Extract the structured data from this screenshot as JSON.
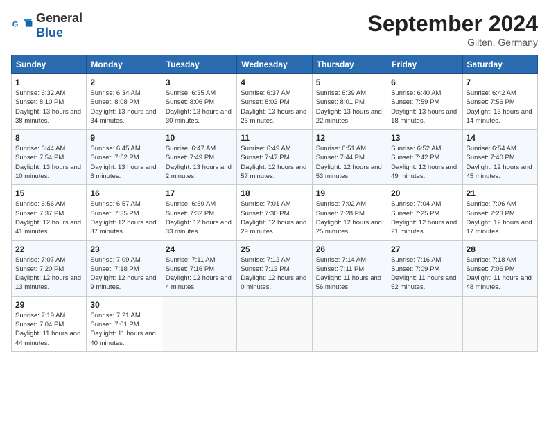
{
  "header": {
    "logo_general": "General",
    "logo_blue": "Blue",
    "month_title": "September 2024",
    "location": "Gilten, Germany"
  },
  "days_of_week": [
    "Sunday",
    "Monday",
    "Tuesday",
    "Wednesday",
    "Thursday",
    "Friday",
    "Saturday"
  ],
  "weeks": [
    [
      {
        "day": "1",
        "sunrise": "6:32 AM",
        "sunset": "8:10 PM",
        "daylight": "Daylight: 13 hours and 38 minutes."
      },
      {
        "day": "2",
        "sunrise": "6:34 AM",
        "sunset": "8:08 PM",
        "daylight": "Daylight: 13 hours and 34 minutes."
      },
      {
        "day": "3",
        "sunrise": "6:35 AM",
        "sunset": "8:06 PM",
        "daylight": "Daylight: 13 hours and 30 minutes."
      },
      {
        "day": "4",
        "sunrise": "6:37 AM",
        "sunset": "8:03 PM",
        "daylight": "Daylight: 13 hours and 26 minutes."
      },
      {
        "day": "5",
        "sunrise": "6:39 AM",
        "sunset": "8:01 PM",
        "daylight": "Daylight: 13 hours and 22 minutes."
      },
      {
        "day": "6",
        "sunrise": "6:40 AM",
        "sunset": "7:59 PM",
        "daylight": "Daylight: 13 hours and 18 minutes."
      },
      {
        "day": "7",
        "sunrise": "6:42 AM",
        "sunset": "7:56 PM",
        "daylight": "Daylight: 13 hours and 14 minutes."
      }
    ],
    [
      {
        "day": "8",
        "sunrise": "6:44 AM",
        "sunset": "7:54 PM",
        "daylight": "Daylight: 13 hours and 10 minutes."
      },
      {
        "day": "9",
        "sunrise": "6:45 AM",
        "sunset": "7:52 PM",
        "daylight": "Daylight: 13 hours and 6 minutes."
      },
      {
        "day": "10",
        "sunrise": "6:47 AM",
        "sunset": "7:49 PM",
        "daylight": "Daylight: 13 hours and 2 minutes."
      },
      {
        "day": "11",
        "sunrise": "6:49 AM",
        "sunset": "7:47 PM",
        "daylight": "Daylight: 12 hours and 57 minutes."
      },
      {
        "day": "12",
        "sunrise": "6:51 AM",
        "sunset": "7:44 PM",
        "daylight": "Daylight: 12 hours and 53 minutes."
      },
      {
        "day": "13",
        "sunrise": "6:52 AM",
        "sunset": "7:42 PM",
        "daylight": "Daylight: 12 hours and 49 minutes."
      },
      {
        "day": "14",
        "sunrise": "6:54 AM",
        "sunset": "7:40 PM",
        "daylight": "Daylight: 12 hours and 45 minutes."
      }
    ],
    [
      {
        "day": "15",
        "sunrise": "6:56 AM",
        "sunset": "7:37 PM",
        "daylight": "Daylight: 12 hours and 41 minutes."
      },
      {
        "day": "16",
        "sunrise": "6:57 AM",
        "sunset": "7:35 PM",
        "daylight": "Daylight: 12 hours and 37 minutes."
      },
      {
        "day": "17",
        "sunrise": "6:59 AM",
        "sunset": "7:32 PM",
        "daylight": "Daylight: 12 hours and 33 minutes."
      },
      {
        "day": "18",
        "sunrise": "7:01 AM",
        "sunset": "7:30 PM",
        "daylight": "Daylight: 12 hours and 29 minutes."
      },
      {
        "day": "19",
        "sunrise": "7:02 AM",
        "sunset": "7:28 PM",
        "daylight": "Daylight: 12 hours and 25 minutes."
      },
      {
        "day": "20",
        "sunrise": "7:04 AM",
        "sunset": "7:25 PM",
        "daylight": "Daylight: 12 hours and 21 minutes."
      },
      {
        "day": "21",
        "sunrise": "7:06 AM",
        "sunset": "7:23 PM",
        "daylight": "Daylight: 12 hours and 17 minutes."
      }
    ],
    [
      {
        "day": "22",
        "sunrise": "7:07 AM",
        "sunset": "7:20 PM",
        "daylight": "Daylight: 12 hours and 13 minutes."
      },
      {
        "day": "23",
        "sunrise": "7:09 AM",
        "sunset": "7:18 PM",
        "daylight": "Daylight: 12 hours and 9 minutes."
      },
      {
        "day": "24",
        "sunrise": "7:11 AM",
        "sunset": "7:16 PM",
        "daylight": "Daylight: 12 hours and 4 minutes."
      },
      {
        "day": "25",
        "sunrise": "7:12 AM",
        "sunset": "7:13 PM",
        "daylight": "Daylight: 12 hours and 0 minutes."
      },
      {
        "day": "26",
        "sunrise": "7:14 AM",
        "sunset": "7:11 PM",
        "daylight": "Daylight: 11 hours and 56 minutes."
      },
      {
        "day": "27",
        "sunrise": "7:16 AM",
        "sunset": "7:09 PM",
        "daylight": "Daylight: 11 hours and 52 minutes."
      },
      {
        "day": "28",
        "sunrise": "7:18 AM",
        "sunset": "7:06 PM",
        "daylight": "Daylight: 11 hours and 48 minutes."
      }
    ],
    [
      {
        "day": "29",
        "sunrise": "7:19 AM",
        "sunset": "7:04 PM",
        "daylight": "Daylight: 11 hours and 44 minutes."
      },
      {
        "day": "30",
        "sunrise": "7:21 AM",
        "sunset": "7:01 PM",
        "daylight": "Daylight: 11 hours and 40 minutes."
      },
      null,
      null,
      null,
      null,
      null
    ]
  ]
}
